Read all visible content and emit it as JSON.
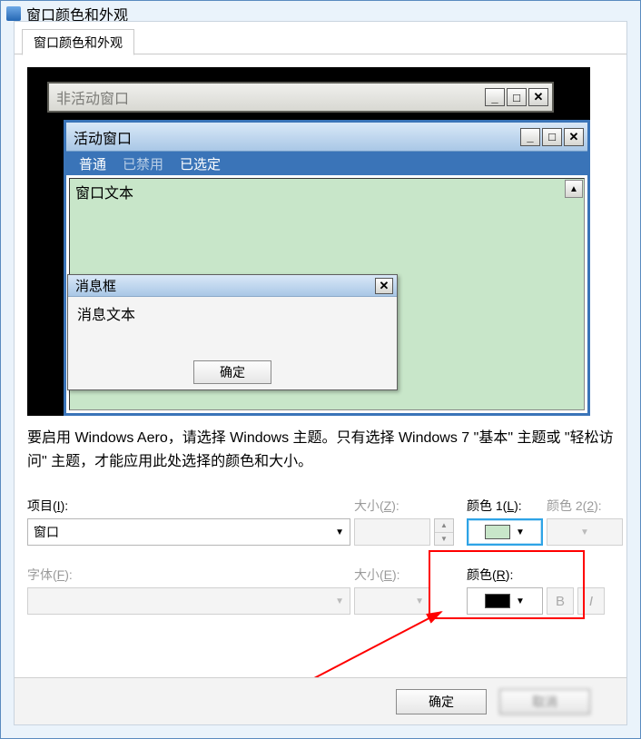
{
  "window_title": "窗口颜色和外观",
  "tab_label": "窗口颜色和外观",
  "preview": {
    "inactive_title": "非活动窗口",
    "active_title": "活动窗口",
    "menu_normal": "普通",
    "menu_disabled": "已禁用",
    "menu_selected": "已选定",
    "window_text": "窗口文本",
    "msgbox_title": "消息框",
    "msgbox_body": "消息文本",
    "msgbox_ok": "确定"
  },
  "description": "要启用 Windows Aero，请选择 Windows 主题。只有选择 Windows 7 \"基本\" 主题或 \"轻松访问\" 主题，才能应用此处选择的颜色和大小。",
  "form": {
    "item_label_pre": "项目(",
    "item_label_key": "I",
    "item_label_post": "):",
    "item_value": "窗口",
    "size_label_pre": "大小(",
    "size_label_key": "Z",
    "size_label_post": "):",
    "size_value": "",
    "color1_label_pre": "颜色 1(",
    "color1_label_key": "L",
    "color1_label_post": "):",
    "color1_hex": "#c8e6c9",
    "color2_label_pre": "颜色 2(",
    "color2_label_key": "2",
    "color2_label_post": "):",
    "font_label_pre": "字体(",
    "font_label_key": "F",
    "font_label_post": "):",
    "font_value": "",
    "fsize_label_pre": "大小(",
    "fsize_label_key": "E",
    "fsize_label_post": "):",
    "fsize_value": "",
    "fcolor_label_pre": "颜色(",
    "fcolor_label_key": "R",
    "fcolor_label_post": "):",
    "fcolor_hex": "#000000",
    "bold": "B",
    "italic": "I"
  },
  "dialog": {
    "ok": "确定",
    "cancel": "取消"
  }
}
